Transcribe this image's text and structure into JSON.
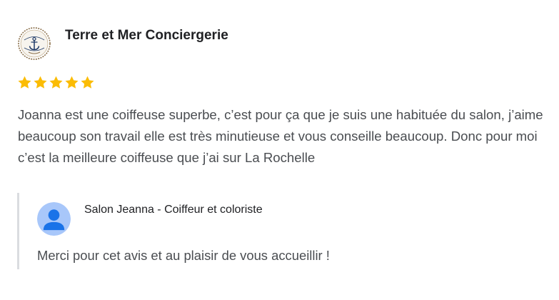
{
  "review": {
    "author_name": "Terre et Mer Conciergerie",
    "author_logo_text": "Terre & Mer",
    "rating": 5,
    "stars": [
      "star",
      "star",
      "star",
      "star",
      "star"
    ],
    "text": "Joanna est une coiffeuse superbe, c’est pour ça que je suis une habituée du salon, j’aime beaucoup son travail elle est très minutieuse et vous conseille beaucoup. Donc pour moi c’est la meilleure coiffeuse que j’ai sur La Rochelle"
  },
  "reply": {
    "owner_name": "Salon Jeanna - Coiffeur et coloriste",
    "text": "Merci pour cet avis et au plaisir de vous accueillir !"
  },
  "colors": {
    "star": "#fbbc04",
    "reply_border": "#dadce0",
    "default_avatar_bg": "#a8c7fa",
    "default_avatar_fg": "#1a73e8",
    "logo_navy": "#1f3a68"
  },
  "icons": {
    "author_avatar": "anchor-logo-icon",
    "owner_avatar": "default-person-icon",
    "star": "star-icon"
  }
}
